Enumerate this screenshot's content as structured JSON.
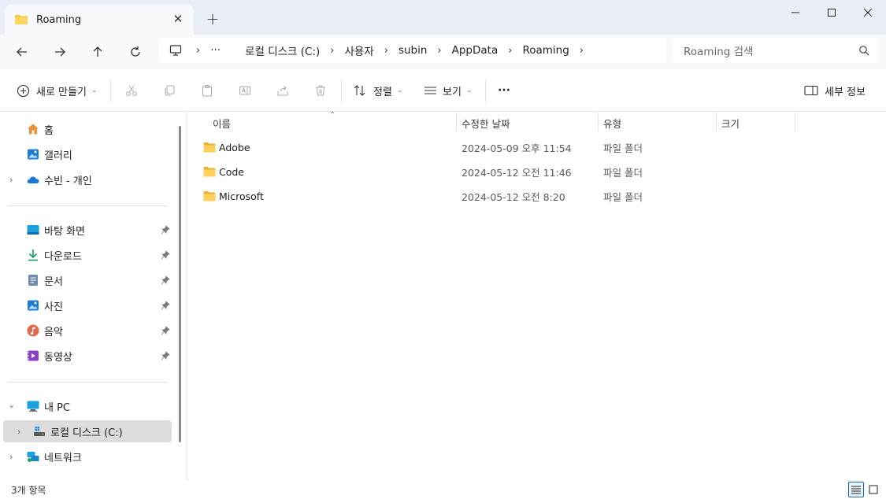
{
  "window": {
    "tab_title": "Roaming",
    "tab_close": "✕",
    "new_tab": "+"
  },
  "breadcrumb": {
    "overflow": "···",
    "items": [
      "로컬 디스크 (C:)",
      "사용자",
      "subin",
      "AppData",
      "Roaming"
    ]
  },
  "search": {
    "placeholder": "Roaming 검색"
  },
  "commandbar": {
    "new": "새로 만들기",
    "sort": "정렬",
    "view": "보기",
    "more": "···",
    "details": "세부 정보"
  },
  "sidebar": {
    "home": "홈",
    "gallery": "갤러리",
    "onedrive": "수빈 - 개인",
    "quick_access": [
      "바탕 화면",
      "다운로드",
      "문서",
      "사진",
      "음악",
      "동영상"
    ],
    "this_pc": "내 PC",
    "local_disk": "로컬 디스크 (C:)",
    "network": "네트워크"
  },
  "columns": {
    "name": "이름",
    "modified": "수정한 날짜",
    "type": "유형",
    "size": "크기"
  },
  "files": [
    {
      "name": "Adobe",
      "modified": "2024-05-09 오후 11:54",
      "type": "파일 폴더"
    },
    {
      "name": "Code",
      "modified": "2024-05-12 오전 11:46",
      "type": "파일 폴더"
    },
    {
      "name": "Microsoft",
      "modified": "2024-05-12 오전 8:20",
      "type": "파일 폴더"
    }
  ],
  "status": {
    "item_count": "3개 항목"
  },
  "colors": {
    "folder": "#f4c542",
    "accent": "#0a64c8",
    "selected": "#dcdcdc"
  }
}
